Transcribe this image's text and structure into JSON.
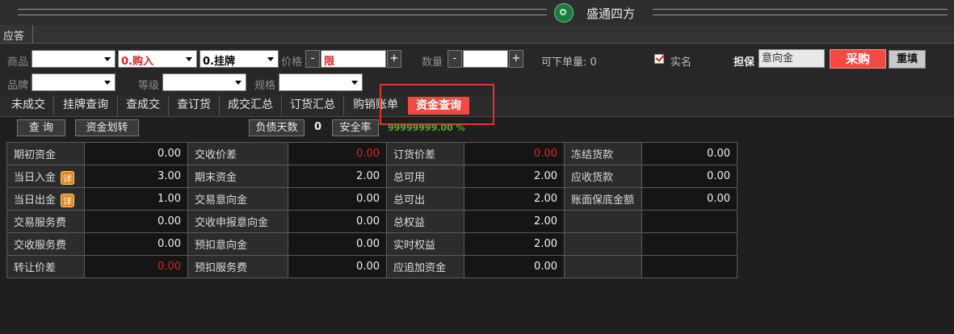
{
  "window": {
    "title": "盛通四方"
  },
  "reply_tab": "应答",
  "form": {
    "product_label": "商品",
    "product_value": "",
    "direction_value": "0.购入",
    "order_type_value": "0.挂牌",
    "price_label": "价格",
    "minus": "-",
    "plus": "+",
    "price_value": "限",
    "qty_label": "数量",
    "qty_value": "",
    "max_qty_label": "可下单量: 0",
    "real_name_label": "实名",
    "real_name_checked": true,
    "margin_label": "担保",
    "margin_value": "意向金",
    "buy_button": "采购",
    "reset_button": "重填",
    "brand_label": "品牌",
    "brand_value": "",
    "grade_label": "等级",
    "grade_value": "",
    "spec_label": "规格",
    "spec_value": ""
  },
  "tabs": [
    "未成交",
    "挂牌查询",
    "查成交",
    "查订货",
    "成交汇总",
    "订货汇总",
    "购销账单",
    "资金查询"
  ],
  "active_tab": "资金查询",
  "toolbar": {
    "query_button": "查 询",
    "transfer_button": "资金划转",
    "debt_days_button": "负债天数",
    "debt_days_value": "0",
    "safety_rate_button": "安全率",
    "safety_rate_value": "99999999.00 %"
  },
  "fund_table": [
    [
      {
        "k": "期初资金",
        "v": "0.00"
      },
      {
        "k": "交收价差",
        "v": "0.00",
        "red": true
      },
      {
        "k": "订货价差",
        "v": "0.00",
        "red": true
      },
      {
        "k": "冻结货款",
        "v": "0.00"
      }
    ],
    [
      {
        "k": "当日入金",
        "v": "3.00",
        "badge": "详"
      },
      {
        "k": "期末资金",
        "v": "2.00"
      },
      {
        "k": "总可用",
        "v": "2.00"
      },
      {
        "k": "应收货款",
        "v": "0.00"
      }
    ],
    [
      {
        "k": "当日出金",
        "v": "1.00",
        "badge": "详"
      },
      {
        "k": "交易意向金",
        "v": "0.00"
      },
      {
        "k": "总可出",
        "v": "2.00"
      },
      {
        "k": "账面保底金额",
        "v": "0.00"
      }
    ],
    [
      {
        "k": "交易服务费",
        "v": "0.00"
      },
      {
        "k": "交收申报意向金",
        "v": "0.00"
      },
      {
        "k": "总权益",
        "v": "2.00"
      },
      {
        "k": "",
        "v": ""
      }
    ],
    [
      {
        "k": "交收服务费",
        "v": "0.00"
      },
      {
        "k": "预扣意向金",
        "v": "0.00"
      },
      {
        "k": "实时权益",
        "v": "2.00"
      },
      {
        "k": "",
        "v": ""
      }
    ],
    [
      {
        "k": "转让价差",
        "v": "0.00",
        "red": true
      },
      {
        "k": "预扣服务费",
        "v": "0.00"
      },
      {
        "k": "应追加资金",
        "v": "0.00"
      },
      {
        "k": "",
        "v": ""
      }
    ]
  ],
  "colors": {
    "accent": "#f04a42",
    "highlight_box": "#e2332c",
    "negative": "#e02020",
    "safety": "#5aa832"
  }
}
